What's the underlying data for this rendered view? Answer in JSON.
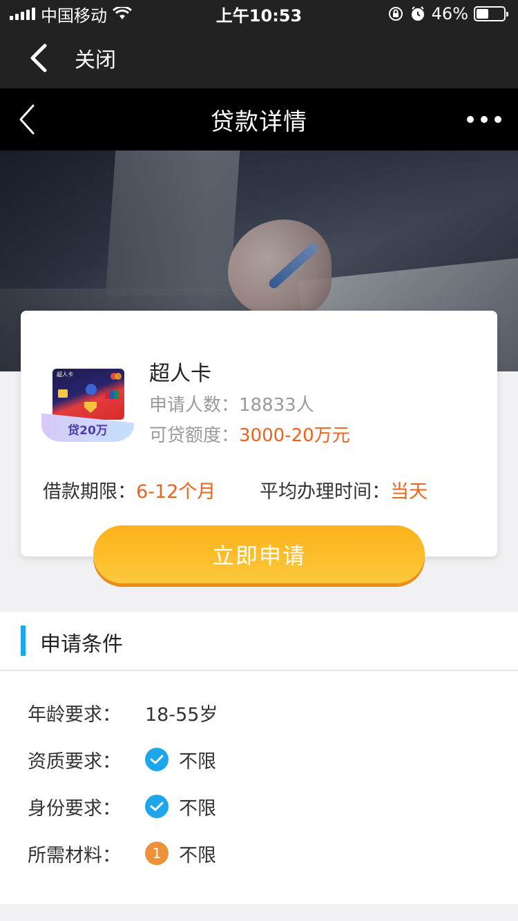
{
  "status_bar": {
    "carrier": "中国移动",
    "time": "上午10:53",
    "battery": "46%",
    "battery_level": 0.46
  },
  "close_bar": {
    "label": "关闭"
  },
  "title_bar": {
    "title": "贷款详情"
  },
  "product": {
    "name": "超人卡",
    "card_badge": "贷20万",
    "card_print": "超人卡",
    "applicants_label": "申请人数：",
    "applicants_value": "18833人",
    "amount_label": "可贷额度：",
    "amount_value": "3000-20万元",
    "term_label": "借款期限：",
    "term_value": "6-12个月",
    "time_label": "平均办理时间：",
    "time_value": "当天"
  },
  "apply_button": "立即申请",
  "conditions": {
    "title": "申请条件",
    "rows": [
      {
        "label": "年龄要求：",
        "value": "18-55岁",
        "icon": "none"
      },
      {
        "label": "资质要求：",
        "value": "不限",
        "icon": "check-icon"
      },
      {
        "label": "身份要求：",
        "value": "不限",
        "icon": "check-icon"
      },
      {
        "label": "所需材料：",
        "value": "不限",
        "icon": "number-icon",
        "icon_text": "1"
      }
    ]
  },
  "colors": {
    "accent_blue": "#1ea6ea",
    "accent_orange": "#f0621a",
    "button_yellow": "#fdb21b"
  }
}
